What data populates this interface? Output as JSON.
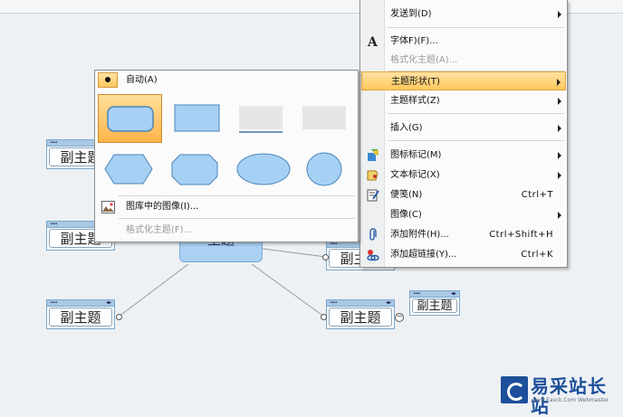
{
  "topics": {
    "t1": "副主题",
    "t2": "副主题",
    "t3": "副主题",
    "t4": "副主题",
    "t5": "副主题",
    "t6": "副主题",
    "central": "主题"
  },
  "context_menu": {
    "send_to": "发送到(D)",
    "font": "字体F)(F)...",
    "format_topic": "格式化主题(A)...",
    "topic_shape": "主题形状(T)",
    "topic_style": "主题样式(Z)",
    "insert": "插入(G)",
    "icon_marker": "图标标记(M)",
    "text_marker": "文本标记(X)",
    "note": "便笺(N)",
    "note_sc": "Ctrl+T",
    "image": "图像(C)",
    "attach": "添加附件(H)...",
    "attach_sc": "Ctrl+Shift+H",
    "hyperlink": "添加超链接(Y)...",
    "hyperlink_sc": "Ctrl+K"
  },
  "shape_menu": {
    "auto": "自动(A)",
    "gallery_image": "图库中的图像(I)...",
    "format_topic": "格式化主题(F)..."
  },
  "watermark": {
    "title": "易采站长站",
    "url": "www.Easck.Com Webmaster"
  }
}
